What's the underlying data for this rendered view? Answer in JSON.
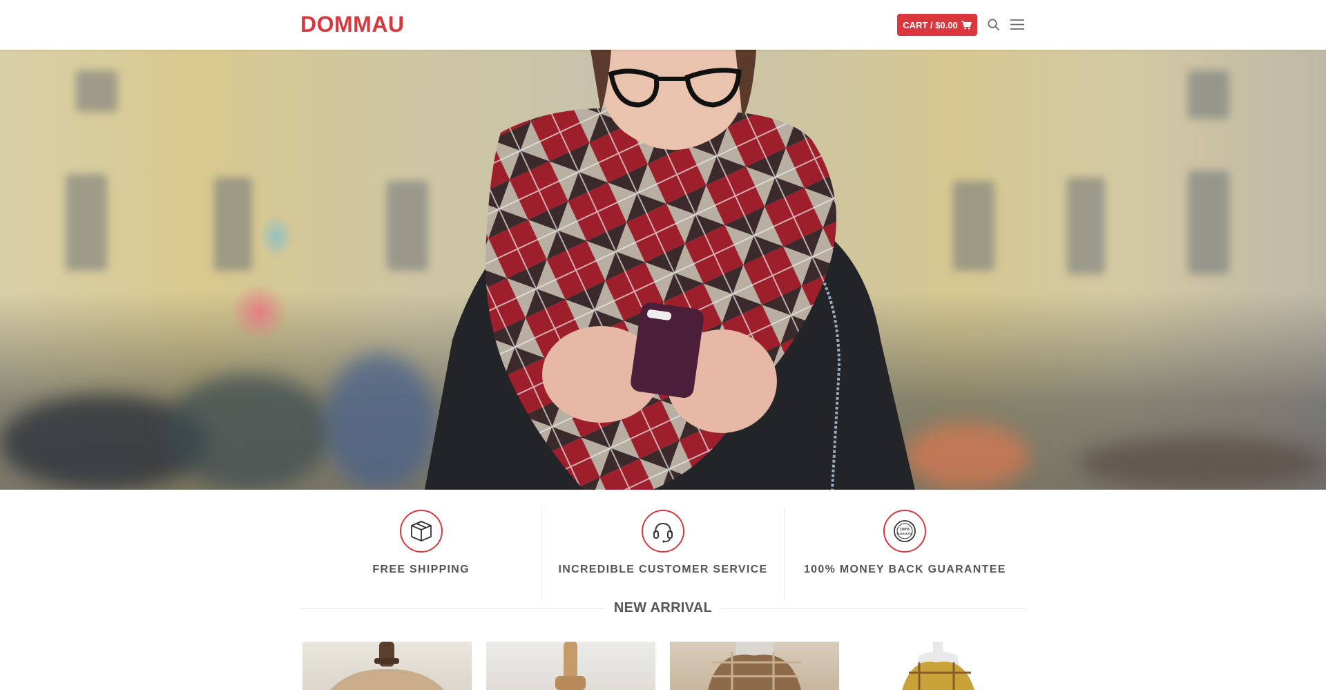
{
  "header": {
    "logo": "DOMMAU",
    "cart_label": "CART / $0.00",
    "cart_icon": "shopping-cart-icon",
    "search_icon": "search-icon",
    "menu_icon": "hamburger-menu-icon"
  },
  "hero": {
    "image": "woman-in-plaid-scarf-using-phone"
  },
  "features": [
    {
      "icon": "package-box-icon",
      "label": "FREE SHIPPING"
    },
    {
      "icon": "headset-icon",
      "label": "INCREDIBLE CUSTOMER SERVICE"
    },
    {
      "icon": "guarantee-badge-icon",
      "label": "100% MONEY BACK GUARANTEE",
      "badge_text": "100% GUARANTEE"
    }
  ],
  "section": {
    "title": "NEW ARRIVAL"
  },
  "products": [
    {
      "image": "scarf-on-mannequin-beige"
    },
    {
      "image": "scarf-on-wooden-stand"
    },
    {
      "image": "plaid-scarf-brown"
    },
    {
      "image": "plaid-scarf-yellow-on-mannequin"
    }
  ],
  "colors": {
    "accent": "#d9363e",
    "text": "#555555"
  }
}
